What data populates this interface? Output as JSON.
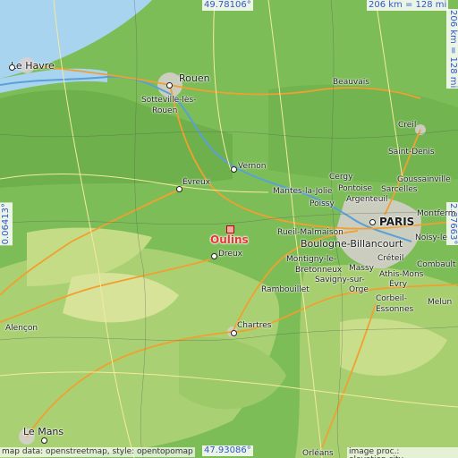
{
  "map": {
    "top_lat": "49.78106°",
    "bottom_lat": "47.93086°",
    "left_lon": "0.06413°",
    "right_lon": "2.87663°",
    "scale_h": "206 km = 128 mi",
    "scale_v": "206 km = 128 mi",
    "attribution_left": "map data: openstreetmap, style: opentopomap",
    "attribution_right": "image proc.: elevation.city",
    "target": "Oulins",
    "places": [
      {
        "name": "Le Havre"
      },
      {
        "name": "Rouen"
      },
      {
        "name": "Sotteville-lès-"
      },
      {
        "name": "Rouen"
      },
      {
        "name": "Beauvais"
      },
      {
        "name": "Creil"
      },
      {
        "name": "Saint-Denis"
      },
      {
        "name": "Vernon"
      },
      {
        "name": "Évreux"
      },
      {
        "name": "Cergy"
      },
      {
        "name": "Pontoise"
      },
      {
        "name": "Argenteuil"
      },
      {
        "name": "Goussainville"
      },
      {
        "name": "Sarcelles"
      },
      {
        "name": "Montferm"
      },
      {
        "name": "Mantes-la-Jolie"
      },
      {
        "name": "Poissy"
      },
      {
        "name": "PARIS"
      },
      {
        "name": "Rueil-Malmaison"
      },
      {
        "name": "Boulogne-Billancourt"
      },
      {
        "name": "Noisy-le"
      },
      {
        "name": "Dreux"
      },
      {
        "name": "Montigny-le-"
      },
      {
        "name": "Bretonneux"
      },
      {
        "name": "Massy"
      },
      {
        "name": "Créteil"
      },
      {
        "name": "Combault"
      },
      {
        "name": "Savigny-sur-"
      },
      {
        "name": "Orge"
      },
      {
        "name": "Athis-Mons"
      },
      {
        "name": "Évry"
      },
      {
        "name": "Rambouillet"
      },
      {
        "name": "Corbeil-"
      },
      {
        "name": "Essonnes"
      },
      {
        "name": "Melun"
      },
      {
        "name": "Chartres"
      },
      {
        "name": "Alençon"
      },
      {
        "name": "Le Mans"
      },
      {
        "name": "Orléans"
      }
    ]
  },
  "colors": {
    "accent": "#3355cc",
    "target": "#e33333",
    "land": "#7fbf5a",
    "sea": "#a8d4f0"
  }
}
